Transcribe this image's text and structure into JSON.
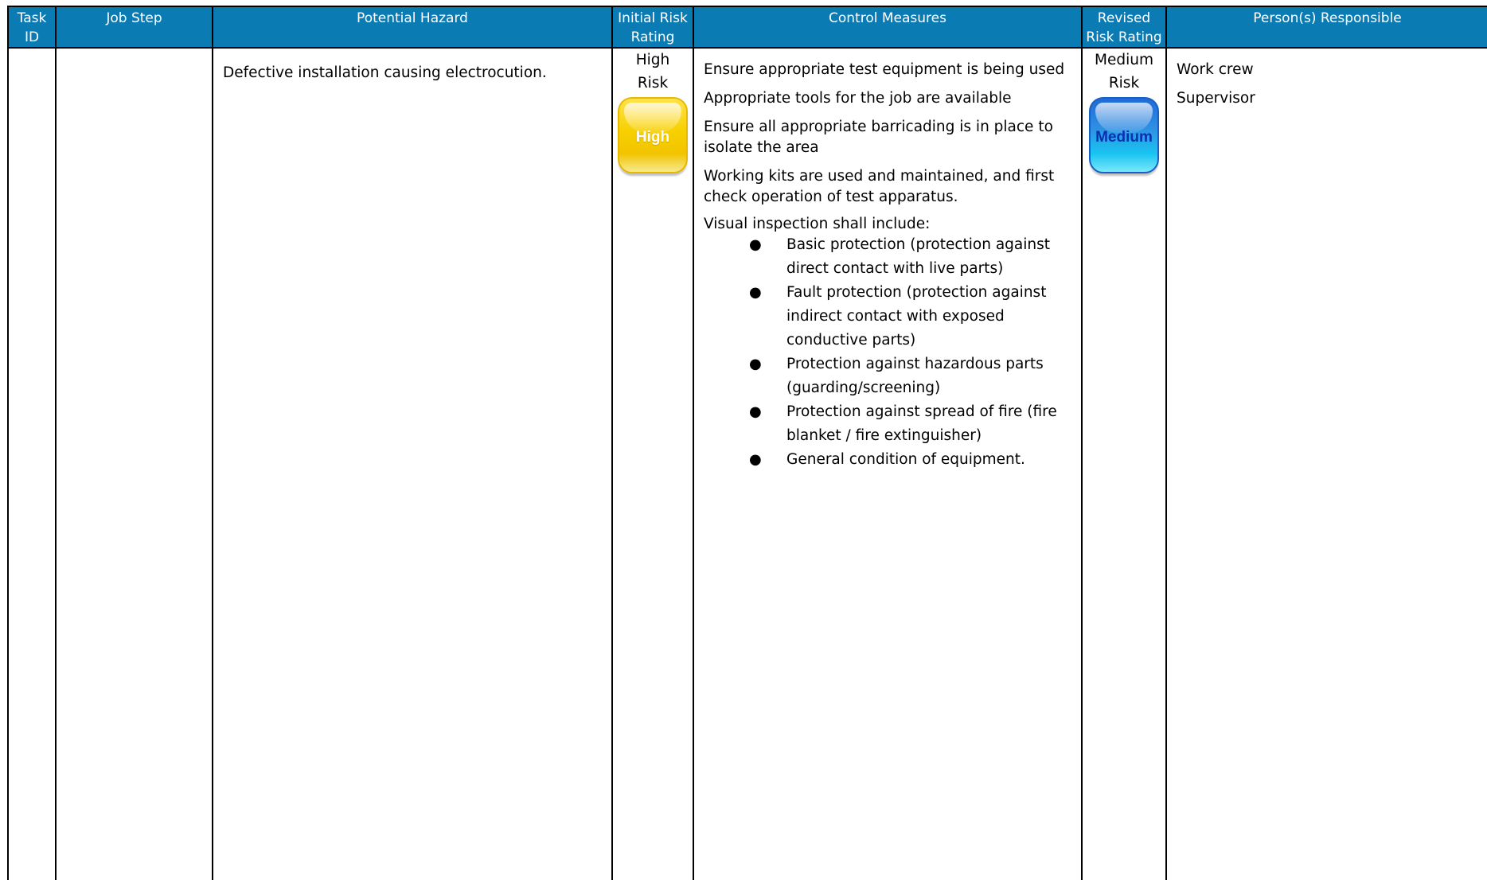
{
  "headers": {
    "task_id": "Task ID",
    "job_step": "Job Step",
    "potential_hazard": "Potential Hazard",
    "initial_risk_rating": "Initial Risk Rating",
    "control_measures": "Control Measures",
    "revised_risk_rating": "Revised Risk Rating",
    "persons_responsible": "Person(s) Responsible"
  },
  "row": {
    "task_id": "",
    "job_step": "",
    "potential_hazard": "Defective installation causing electrocution.",
    "initial_risk": {
      "label_line1": "High",
      "label_line2": "Risk",
      "badge_text": "High",
      "badge_color": "#f7d000"
    },
    "control_measures": [
      "Ensure appropriate test equipment is being used",
      "Appropriate tools for the job are available",
      "Ensure all appropriate barricading is in place to isolate the area",
      "Working kits are used and maintained, and first check operation of test apparatus."
    ],
    "visual_inspection": {
      "title": "Visual inspection shall include:",
      "items": [
        "Basic protection (protection against direct contact with live parts)",
        "Fault protection (protection against indirect contact with exposed conductive parts)",
        "Protection against hazardous parts (guarding/screening)",
        "Protection against spread of fire (fire blanket / fire extinguisher)",
        "General condition of equipment."
      ]
    },
    "revised_risk": {
      "label_line1": "Medium",
      "label_line2": "Risk",
      "badge_text": "Medium",
      "badge_color": "#2f8fe3"
    },
    "persons": [
      "Work crew",
      "Supervisor"
    ]
  },
  "colors": {
    "header_background": "#0b7bb3",
    "header_text": "#ffffff",
    "border": "#000000"
  }
}
